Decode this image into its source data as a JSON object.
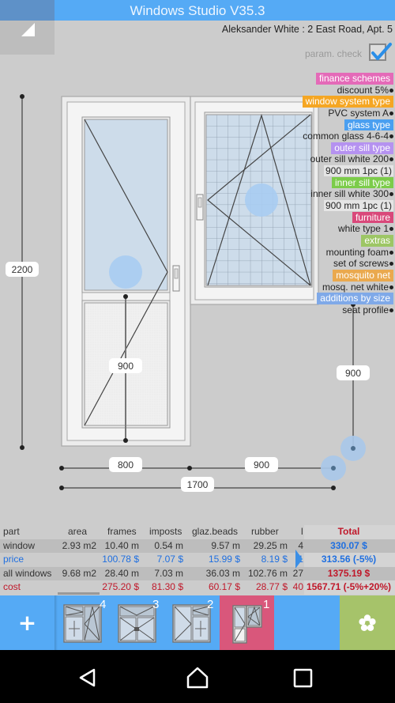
{
  "app": {
    "title": "Windows Studio V35.3",
    "customer": "Aleksander White : 2 East Road, Apt. 5",
    "param_check_label": "param. check",
    "param_check_checked": true
  },
  "colors": {
    "primary_blue": "#55aaf5",
    "active_pink": "#d9577b",
    "extra_green": "#a6c36a",
    "price_blue": "#1f6fe0",
    "cost_red": "#c0182a"
  },
  "dimensions": {
    "total_height": "2200",
    "door_lower_panel_height": "900",
    "window_bottom_height": "900",
    "door_width": "800",
    "window_width": "900",
    "total_width": "1700"
  },
  "params": [
    {
      "type": "category",
      "label": "finance schemes",
      "color": "#e46ab8"
    },
    {
      "type": "value",
      "label": "discount 5%",
      "dot": true
    },
    {
      "type": "category",
      "label": "window system type",
      "color": "#f5a623"
    },
    {
      "type": "value",
      "label": "PVC system A",
      "dot": true
    },
    {
      "type": "category",
      "label": "glass type",
      "color": "#4a9ff0"
    },
    {
      "type": "value",
      "label": "common glass 4-6-4",
      "dot": true
    },
    {
      "type": "category",
      "label": "outer sill type",
      "color": "#b592f0"
    },
    {
      "type": "value",
      "label": "outer sill white 200",
      "dot": true
    },
    {
      "type": "value",
      "label": "900 mm  1pc (1)",
      "dot": false
    },
    {
      "type": "category",
      "label": "inner sill type",
      "color": "#7ccc4a"
    },
    {
      "type": "value",
      "label": "inner sill white 300",
      "dot": true
    },
    {
      "type": "value",
      "label": "900 mm  1pc (1)",
      "dot": false
    },
    {
      "type": "category",
      "label": "furniture",
      "color": "#d9487a"
    },
    {
      "type": "value",
      "label": "white type 1",
      "dot": true
    },
    {
      "type": "category",
      "label": "extras",
      "color": "#9dc665"
    },
    {
      "type": "value",
      "label": "mounting foam",
      "dot": true
    },
    {
      "type": "value",
      "label": "set of screws",
      "dot": true
    },
    {
      "type": "category",
      "label": "mosquito net",
      "color": "#eaa94e"
    },
    {
      "type": "value",
      "label": "mosq. net white",
      "dot": true
    },
    {
      "type": "category",
      "label": "additions by size",
      "color": "#7fa9e8"
    },
    {
      "type": "value",
      "label": "seat profile",
      "dot": true
    }
  ],
  "table": {
    "headers": [
      "part",
      "area",
      "frames",
      "imposts",
      "glaz.beads",
      "rubber",
      "l",
      "Total"
    ],
    "rows": [
      {
        "label": "window",
        "style": "dark",
        "cells": [
          "2.93 m2",
          "10.40 m",
          "0.54 m",
          "9.57 m",
          "29.25 m",
          "4"
        ],
        "total": "330.07 $",
        "total_style": "blue"
      },
      {
        "label": "price",
        "style": "blue",
        "cells": [
          "",
          "100.78  $",
          "7.07  $",
          "15.99  $",
          "8.19  $",
          "1"
        ],
        "total": "313.56 (-5%)",
        "total_style": "blue"
      },
      {
        "label": "all windows",
        "style": "dark",
        "cells": [
          "9.68 m2",
          "28.40 m",
          "7.03 m",
          "36.03 m",
          "102.76 m",
          "27"
        ],
        "total": "1375.19 $",
        "total_style": "red"
      },
      {
        "label": "cost",
        "style": "red",
        "cells": [
          "",
          "275.20  $",
          "81.30  $",
          "60.17  $",
          "28.77  $",
          "40"
        ],
        "total": "1567.71 (-5%+20%)",
        "total_style": "red"
      }
    ]
  },
  "bottom_bar": {
    "add_label": "+",
    "thumbnails": [
      {
        "number": "4",
        "active": false
      },
      {
        "number": "3",
        "active": false
      },
      {
        "number": "2",
        "active": false
      },
      {
        "number": "1",
        "active": true
      }
    ],
    "extra_icon": "flower-icon"
  },
  "navbar": {
    "back_icon": "back-icon",
    "home_icon": "home-icon",
    "recents_icon": "recents-icon"
  }
}
